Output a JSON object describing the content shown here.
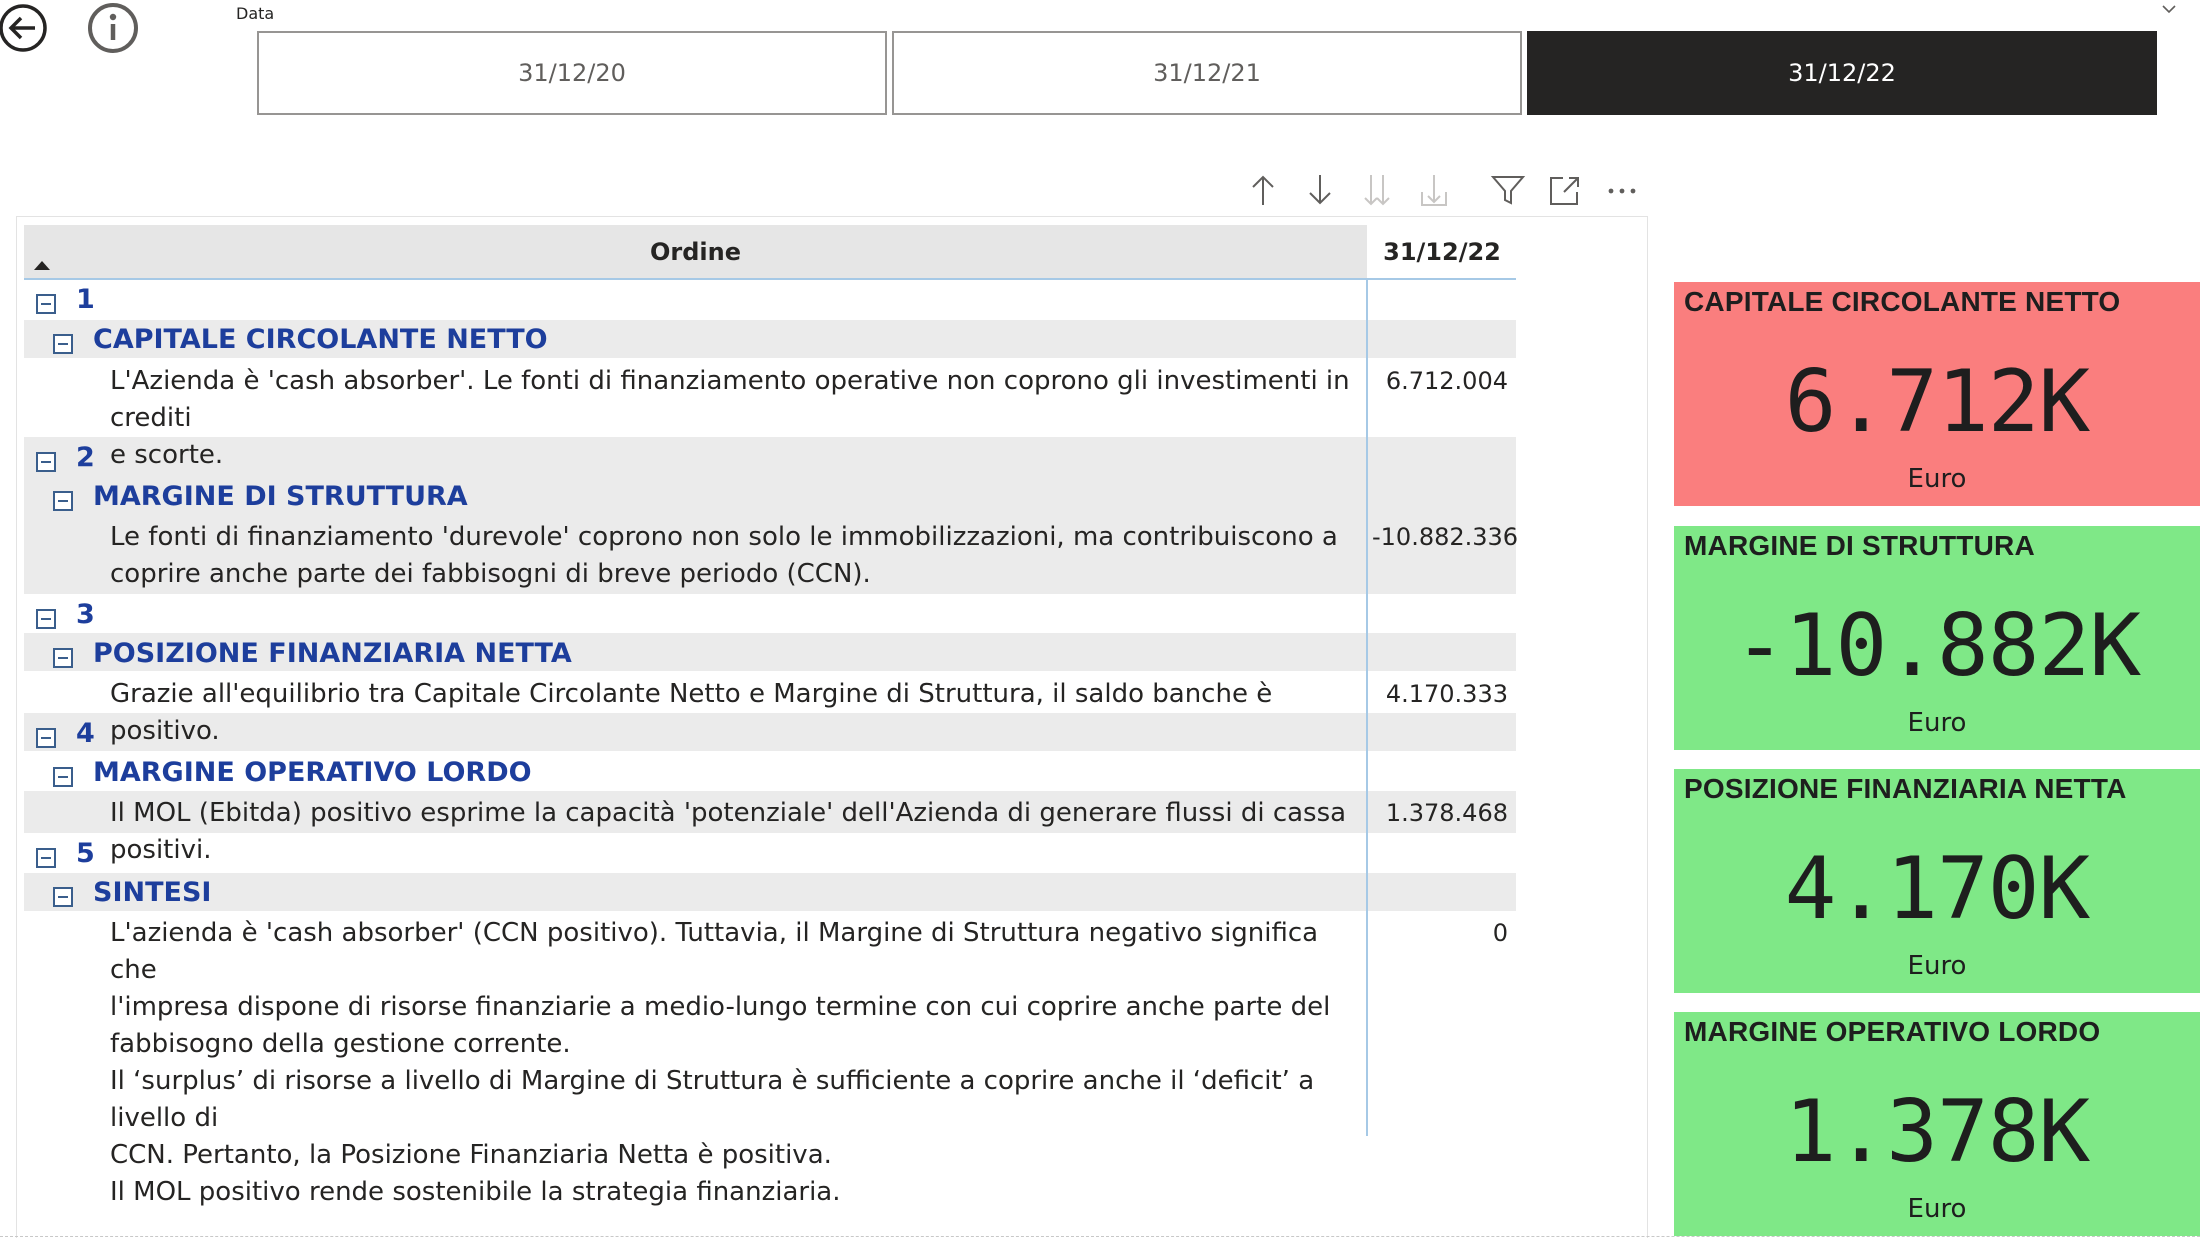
{
  "slicer": {
    "title": "Data",
    "options": [
      "31/12/20",
      "31/12/21",
      "31/12/22"
    ],
    "selected": "31/12/22"
  },
  "matrix": {
    "header": {
      "ordine": "Ordine",
      "date": "31/12/22"
    },
    "groups": [
      {
        "number": "1",
        "title": "CAPITALE CIRCOLANTE NETTO",
        "description": "L'Azienda è 'cash absorber'. Le fonti di finanziamento operative non coprono gli investimenti in crediti\ne scorte.",
        "value": "6.712.004"
      },
      {
        "number": "2",
        "title": "MARGINE DI STRUTTURA",
        "description": "Le fonti di finanziamento 'durevole' coprono non solo le immobilizzazioni, ma contribuiscono a\ncoprire anche parte dei fabbisogni di breve periodo (CCN).",
        "value": "-10.882.336"
      },
      {
        "number": "3",
        "title": "POSIZIONE FINANZIARIA NETTA",
        "description": "Grazie all'equilibrio tra Capitale Circolante Netto e Margine di Struttura, il saldo banche è positivo.",
        "value": "4.170.333"
      },
      {
        "number": "4",
        "title": "MARGINE OPERATIVO LORDO",
        "description": "Il MOL (Ebitda) positivo esprime la capacità 'potenziale' dell'Azienda di generare flussi di cassa positivi.",
        "value": "1.378.468"
      },
      {
        "number": "5",
        "title": "SINTESI",
        "description": "L'azienda è 'cash absorber' (CCN positivo). Tuttavia, il Margine di Struttura negativo significa che\nl'impresa dispone di risorse finanziarie a medio-lungo termine con cui coprire anche parte del\nfabbisogno della gestione corrente.\nIl ‘surplus’ di risorse a livello di Margine di Struttura è sufficiente a coprire anche il ‘deficit’ a livello di\nCCN. Pertanto, la Posizione Finanziaria Netta è positiva.\nIl MOL positivo rende sostenibile la strategia finanziaria.",
        "value": "0"
      }
    ]
  },
  "cards": [
    {
      "title": "CAPITALE CIRCOLANTE NETTO",
      "value": "6.712K",
      "unit": "Euro",
      "status": "negative"
    },
    {
      "title": "MARGINE DI STRUTTURA",
      "value": "-10.882K",
      "unit": "Euro",
      "status": "positive"
    },
    {
      "title": "POSIZIONE FINANZIARIA NETTA",
      "value": "4.170K",
      "unit": "Euro",
      "status": "positive"
    },
    {
      "title": "MARGINE OPERATIVO LORDO",
      "value": "1.378K",
      "unit": "Euro",
      "status": "positive"
    }
  ],
  "colors": {
    "card_negative": "#fa7e7e",
    "card_positive": "#7fe887",
    "group_title": "#1d3e9c",
    "slicer_selected": "#252423"
  },
  "icons": {
    "nav": [
      "back-arrow-icon",
      "info-icon"
    ],
    "toolbar": [
      "drill-up-icon",
      "drill-down-icon",
      "go-to-next-level-icon",
      "expand-next-level-icon",
      "filter-icon",
      "focus-mode-icon",
      "more-options-icon"
    ]
  }
}
